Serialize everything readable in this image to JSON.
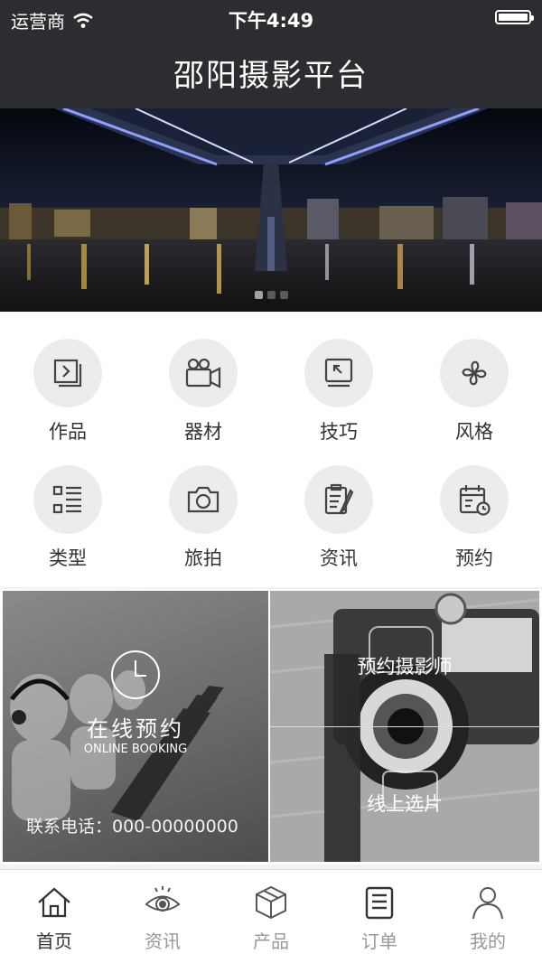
{
  "status_bar": {
    "carrier": "运营商",
    "time": "下午4:49"
  },
  "nav": {
    "title": "邵阳摄影平台"
  },
  "banner": {
    "slide_count": 3,
    "active_index": 0
  },
  "grid": [
    {
      "label": "作品",
      "icon": "works-icon"
    },
    {
      "label": "器材",
      "icon": "camera-video-icon"
    },
    {
      "label": "技巧",
      "icon": "tips-icon"
    },
    {
      "label": "风格",
      "icon": "style-icon"
    },
    {
      "label": "类型",
      "icon": "list-type-icon"
    },
    {
      "label": "旅拍",
      "icon": "camera-icon"
    },
    {
      "label": "资讯",
      "icon": "news-icon"
    },
    {
      "label": "预约",
      "icon": "calendar-icon"
    }
  ],
  "promo": {
    "booking_title": "在线预约",
    "booking_subtitle": "ONLINE BOOKING",
    "phone": "联系电话：000-00000000",
    "book_photographer": "预约摄影师",
    "online_select": "线上选片"
  },
  "tabs": [
    {
      "label": "首页",
      "icon": "home-icon",
      "active": true
    },
    {
      "label": "资讯",
      "icon": "eye-icon",
      "active": false
    },
    {
      "label": "产品",
      "icon": "box-icon",
      "active": false
    },
    {
      "label": "订单",
      "icon": "order-icon",
      "active": false
    },
    {
      "label": "我的",
      "icon": "user-icon",
      "active": false
    }
  ],
  "colors": {
    "header_bg": "#2b2d31",
    "active_tab": "#333333",
    "inactive_tab": "#999999"
  }
}
